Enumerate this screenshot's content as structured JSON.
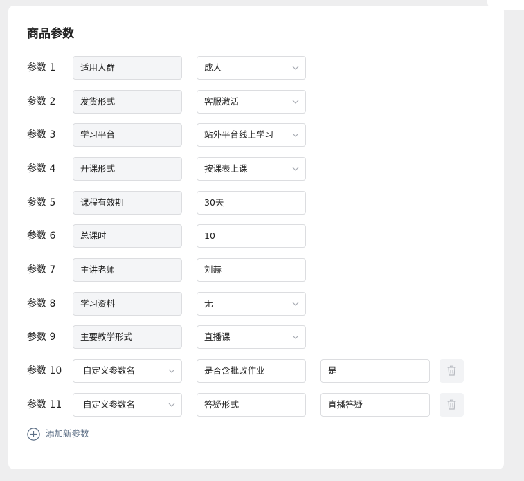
{
  "section_title": "商品参数",
  "rows": [
    {
      "label": "参数 1",
      "name": "适用人群",
      "value": "成人"
    },
    {
      "label": "参数 2",
      "name": "发货形式",
      "value": "客服激活"
    },
    {
      "label": "参数 3",
      "name": "学习平台",
      "value": "站外平台线上学习"
    },
    {
      "label": "参数 4",
      "name": "开课形式",
      "value": "按课表上课"
    },
    {
      "label": "参数 5",
      "name": "课程有效期",
      "value": "30天"
    },
    {
      "label": "参数 6",
      "name": "总课时",
      "value": "10"
    },
    {
      "label": "参数 7",
      "name": "主讲老师",
      "value": "刘赫"
    },
    {
      "label": "参数 8",
      "name": "学习资料",
      "value": "无"
    },
    {
      "label": "参数 9",
      "name": "主要教学形式",
      "value": "直播课"
    },
    {
      "label": "参数 10",
      "type_select": "自定义参数名",
      "name": "是否含批改作业",
      "value": "是"
    },
    {
      "label": "参数 11",
      "type_select": "自定义参数名",
      "name": "答疑形式",
      "value": "直播答疑"
    }
  ],
  "add_param_label": "添加新参数",
  "icons": {
    "chevron": "chevron-down-icon",
    "delete": "trash-icon",
    "add": "plus-circle-icon"
  },
  "colors": {
    "accent_text": "#5d6f86",
    "field_gray": "#f4f5f7",
    "border": "#dcdde0"
  }
}
